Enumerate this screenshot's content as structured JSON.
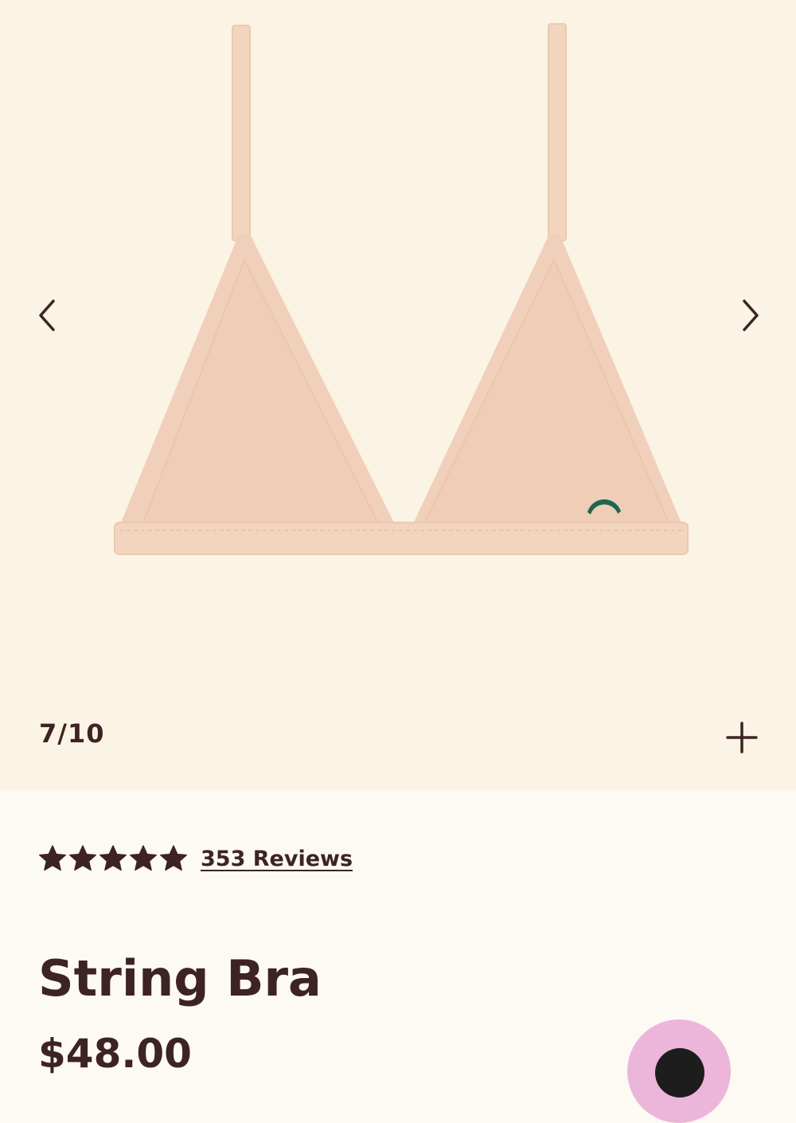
{
  "gallery": {
    "image_alt": "String Bra",
    "counter": "7/10",
    "current_slide": 7,
    "total_slides": 10,
    "prev_icon": "chevron-left-icon",
    "next_icon": "chevron-right-icon",
    "zoom_icon": "plus-icon",
    "background_color": "#fbf3e3",
    "fabric_color": "#f2d5bf",
    "logo_color": "#1e6650"
  },
  "product": {
    "rating": 5,
    "rating_max": 5,
    "reviews_label": "353 Reviews",
    "title": "String Bra",
    "price": "$48.00"
  },
  "chat": {
    "icon": "chat-icon",
    "color": "#ebb6d9"
  },
  "colors": {
    "text": "#3d2324",
    "page_background": "#fdf9f3"
  }
}
